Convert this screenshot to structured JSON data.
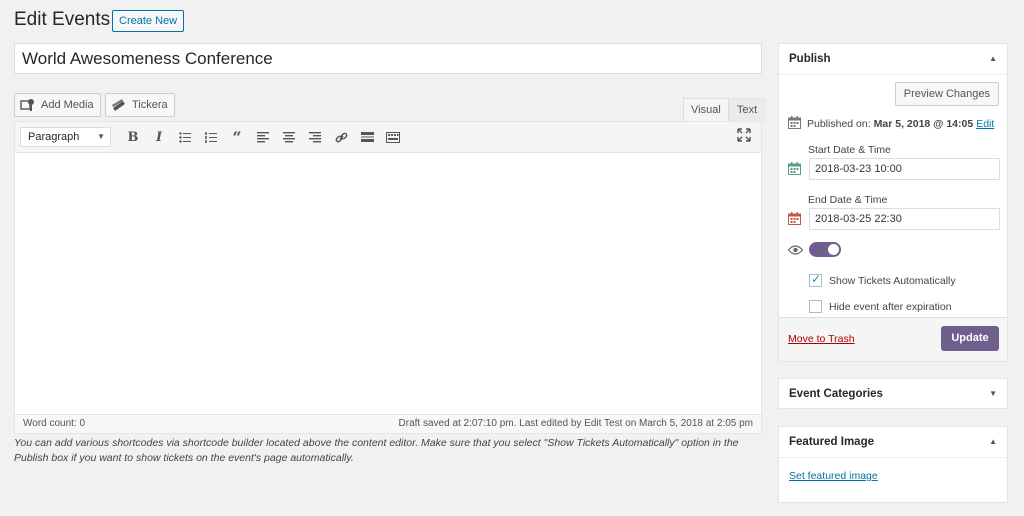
{
  "page": {
    "title": "Edit Events",
    "create_new_label": "Create New"
  },
  "post": {
    "title": "World Awesomeness Conference"
  },
  "media_buttons": {
    "add_media_label": "Add Media",
    "tickera_label": "Tickera"
  },
  "editor_tabs": {
    "visual_label": "Visual",
    "text_label": "Text"
  },
  "toolbar": {
    "format_value": "Paragraph",
    "icons": [
      "bold-icon",
      "italic-icon",
      "bullet-list-icon",
      "numbered-list-icon",
      "blockquote-icon",
      "align-left-icon",
      "align-center-icon",
      "align-right-icon",
      "link-icon",
      "read-more-icon",
      "toolbar-toggle-icon"
    ]
  },
  "status_bar": {
    "word_count": "Word count: 0",
    "draft_saved": "Draft saved at 2:07:10 pm. Last edited by Edit Test on March 5, 2018 at 2:05 pm"
  },
  "help_text": "You can add various shortcodes via shortcode builder located above the content editor. Make sure that you select \"Show Tickets Automatically\" option in the Publish box if you want to show tickets on the event's page automatically.",
  "publish": {
    "header": "Publish",
    "preview_label": "Preview Changes",
    "published_prefix": "Published on:",
    "published_date": "Mar 5, 2018 @ 14:05",
    "edit_label": "Edit",
    "start_label": "Start Date & Time",
    "start_value": "2018-03-23 10:00",
    "end_label": "End Date & Time",
    "end_value": "2018-03-25 22:30",
    "show_tickets_label": "Show Tickets Automatically",
    "hide_event_label": "Hide event after expiration",
    "trash_label": "Move to Trash",
    "update_label": "Update"
  },
  "event_categories": {
    "header": "Event Categories"
  },
  "featured_image": {
    "header": "Featured Image",
    "set_label": "Set featured image"
  },
  "colors": {
    "accent": "#6f5f8f",
    "link": "#0073aa",
    "trash": "#a00000",
    "start_cal": "#5a9a8a",
    "end_cal": "#c9554a"
  }
}
